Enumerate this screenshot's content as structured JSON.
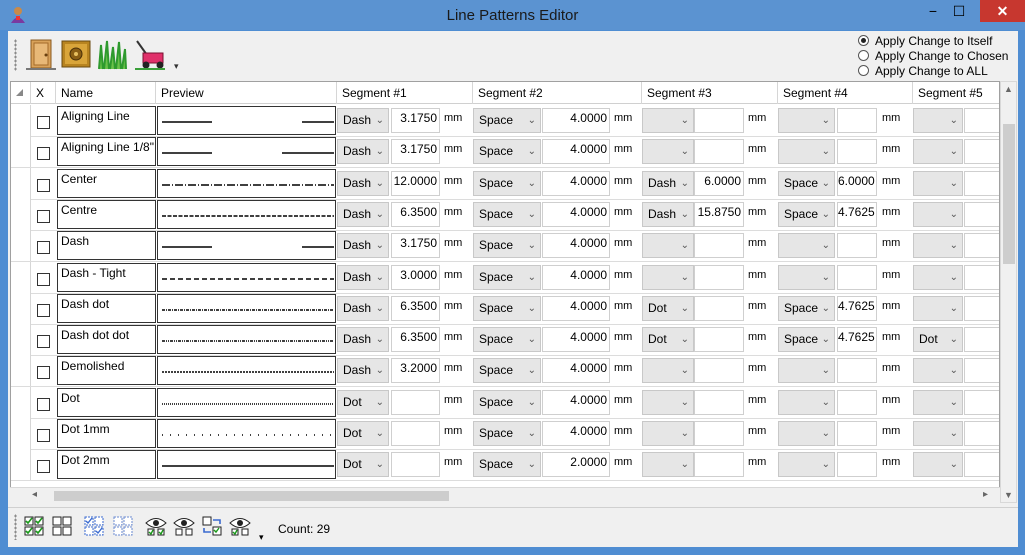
{
  "window": {
    "title": "Line Patterns Editor",
    "minimize": "−",
    "maximize": "☐",
    "close": "✕"
  },
  "toolbar": {
    "icons": [
      "door-icon",
      "safe-icon",
      "grass-icon",
      "lawnmower-icon"
    ],
    "overflow": "▾"
  },
  "apply_options": [
    {
      "label": "Apply Change to Itself",
      "selected": true
    },
    {
      "label": "Apply Change to Chosen",
      "selected": false
    },
    {
      "label": "Apply Change to ALL",
      "selected": false
    }
  ],
  "grid": {
    "columns": [
      "X",
      "Name",
      "Preview",
      "Segment #1",
      "Segment #2",
      "Segment #3",
      "Segment #4",
      "Segment #5"
    ],
    "unit": "mm",
    "rows": [
      {
        "name": "Aligning Line",
        "segs": [
          [
            "Dash",
            "3.1750"
          ],
          [
            "Space",
            "4.0000"
          ],
          [
            "",
            ""
          ],
          [
            "",
            ""
          ],
          [
            "",
            ""
          ]
        ]
      },
      {
        "name": "Aligning Line 1/8\"",
        "segs": [
          [
            "Dash",
            "3.1750"
          ],
          [
            "Space",
            "4.0000"
          ],
          [
            "",
            ""
          ],
          [
            "",
            ""
          ],
          [
            "",
            ""
          ]
        ]
      },
      {
        "name": "Center",
        "segs": [
          [
            "Dash",
            "12.0000"
          ],
          [
            "Space",
            "4.0000"
          ],
          [
            "Dash",
            "6.0000"
          ],
          [
            "Space",
            "6.0000"
          ],
          [
            "",
            ""
          ]
        ]
      },
      {
        "name": "Centre",
        "segs": [
          [
            "Dash",
            "6.3500"
          ],
          [
            "Space",
            "4.0000"
          ],
          [
            "Dash",
            "15.8750"
          ],
          [
            "Space",
            "4.7625"
          ],
          [
            "",
            ""
          ]
        ]
      },
      {
        "name": "Dash",
        "segs": [
          [
            "Dash",
            "3.1750"
          ],
          [
            "Space",
            "4.0000"
          ],
          [
            "",
            ""
          ],
          [
            "",
            ""
          ],
          [
            "",
            ""
          ]
        ]
      },
      {
        "name": "Dash - Tight",
        "segs": [
          [
            "Dash",
            "3.0000"
          ],
          [
            "Space",
            "4.0000"
          ],
          [
            "",
            ""
          ],
          [
            "",
            ""
          ],
          [
            "",
            ""
          ]
        ]
      },
      {
        "name": "Dash dot",
        "segs": [
          [
            "Dash",
            "6.3500"
          ],
          [
            "Space",
            "4.0000"
          ],
          [
            "Dot",
            ""
          ],
          [
            "Space",
            "4.7625"
          ],
          [
            "",
            ""
          ]
        ]
      },
      {
        "name": "Dash dot dot",
        "segs": [
          [
            "Dash",
            "6.3500"
          ],
          [
            "Space",
            "4.0000"
          ],
          [
            "Dot",
            ""
          ],
          [
            "Space",
            "4.7625"
          ],
          [
            "Dot",
            ""
          ]
        ]
      },
      {
        "name": "Demolished",
        "segs": [
          [
            "Dash",
            "3.2000"
          ],
          [
            "Space",
            "4.0000"
          ],
          [
            "",
            ""
          ],
          [
            "",
            ""
          ],
          [
            "",
            ""
          ]
        ]
      },
      {
        "name": "Dot",
        "segs": [
          [
            "Dot",
            ""
          ],
          [
            "Space",
            "4.0000"
          ],
          [
            "",
            ""
          ],
          [
            "",
            ""
          ],
          [
            "",
            ""
          ]
        ]
      },
      {
        "name": "Dot 1mm",
        "segs": [
          [
            "Dot",
            ""
          ],
          [
            "Space",
            "4.0000"
          ],
          [
            "",
            ""
          ],
          [
            "",
            ""
          ],
          [
            "",
            ""
          ]
        ]
      },
      {
        "name": "Dot 2mm",
        "segs": [
          [
            "Dot",
            ""
          ],
          [
            "Space",
            "2.0000"
          ],
          [
            "",
            ""
          ],
          [
            "",
            ""
          ],
          [
            "",
            ""
          ]
        ]
      }
    ]
  },
  "bottom": {
    "count_label": "Count: 29",
    "overflow": "▾"
  }
}
